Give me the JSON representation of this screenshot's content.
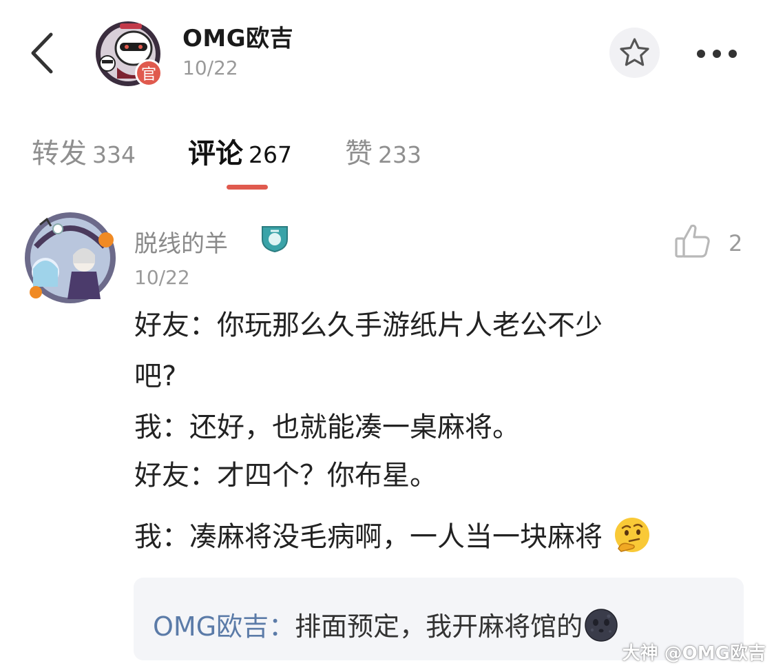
{
  "header": {
    "author_name": "OMG欧吉",
    "post_date": "10/22",
    "official_badge": "官",
    "icons": {
      "back": "chevron-left-icon",
      "favorite": "star-icon",
      "more": "more-dots-icon"
    }
  },
  "tabs": [
    {
      "label": "转发",
      "count": "334",
      "active": false
    },
    {
      "label": "评论",
      "count": "267",
      "active": true
    },
    {
      "label": "赞",
      "count": "233",
      "active": false
    }
  ],
  "comment": {
    "user_name": "脱线的羊",
    "date": "10/22",
    "like_count": "2",
    "lines": [
      "好友：你玩那么久手游纸片人老公不少",
      "吧?",
      "我：还好，也就能凑一桌麻将。",
      "好友：才四个？你布星。",
      "我：凑麻将没毛病啊，一人当一块麻将"
    ],
    "trailing_emoji": "thinking-face-emoji"
  },
  "reply": {
    "author": "OMG欧吉：",
    "text": "排面预定，我开麻将馆的",
    "trailing_emoji": "new-moon-face-emoji"
  },
  "watermark": {
    "brand": "大神",
    "handle": "@OMG欧吉"
  },
  "colors": {
    "accent": "#e05a4e",
    "reply_author": "#5b7ba8",
    "muted": "#9a9a9a",
    "reply_bg": "#f4f5f8"
  }
}
